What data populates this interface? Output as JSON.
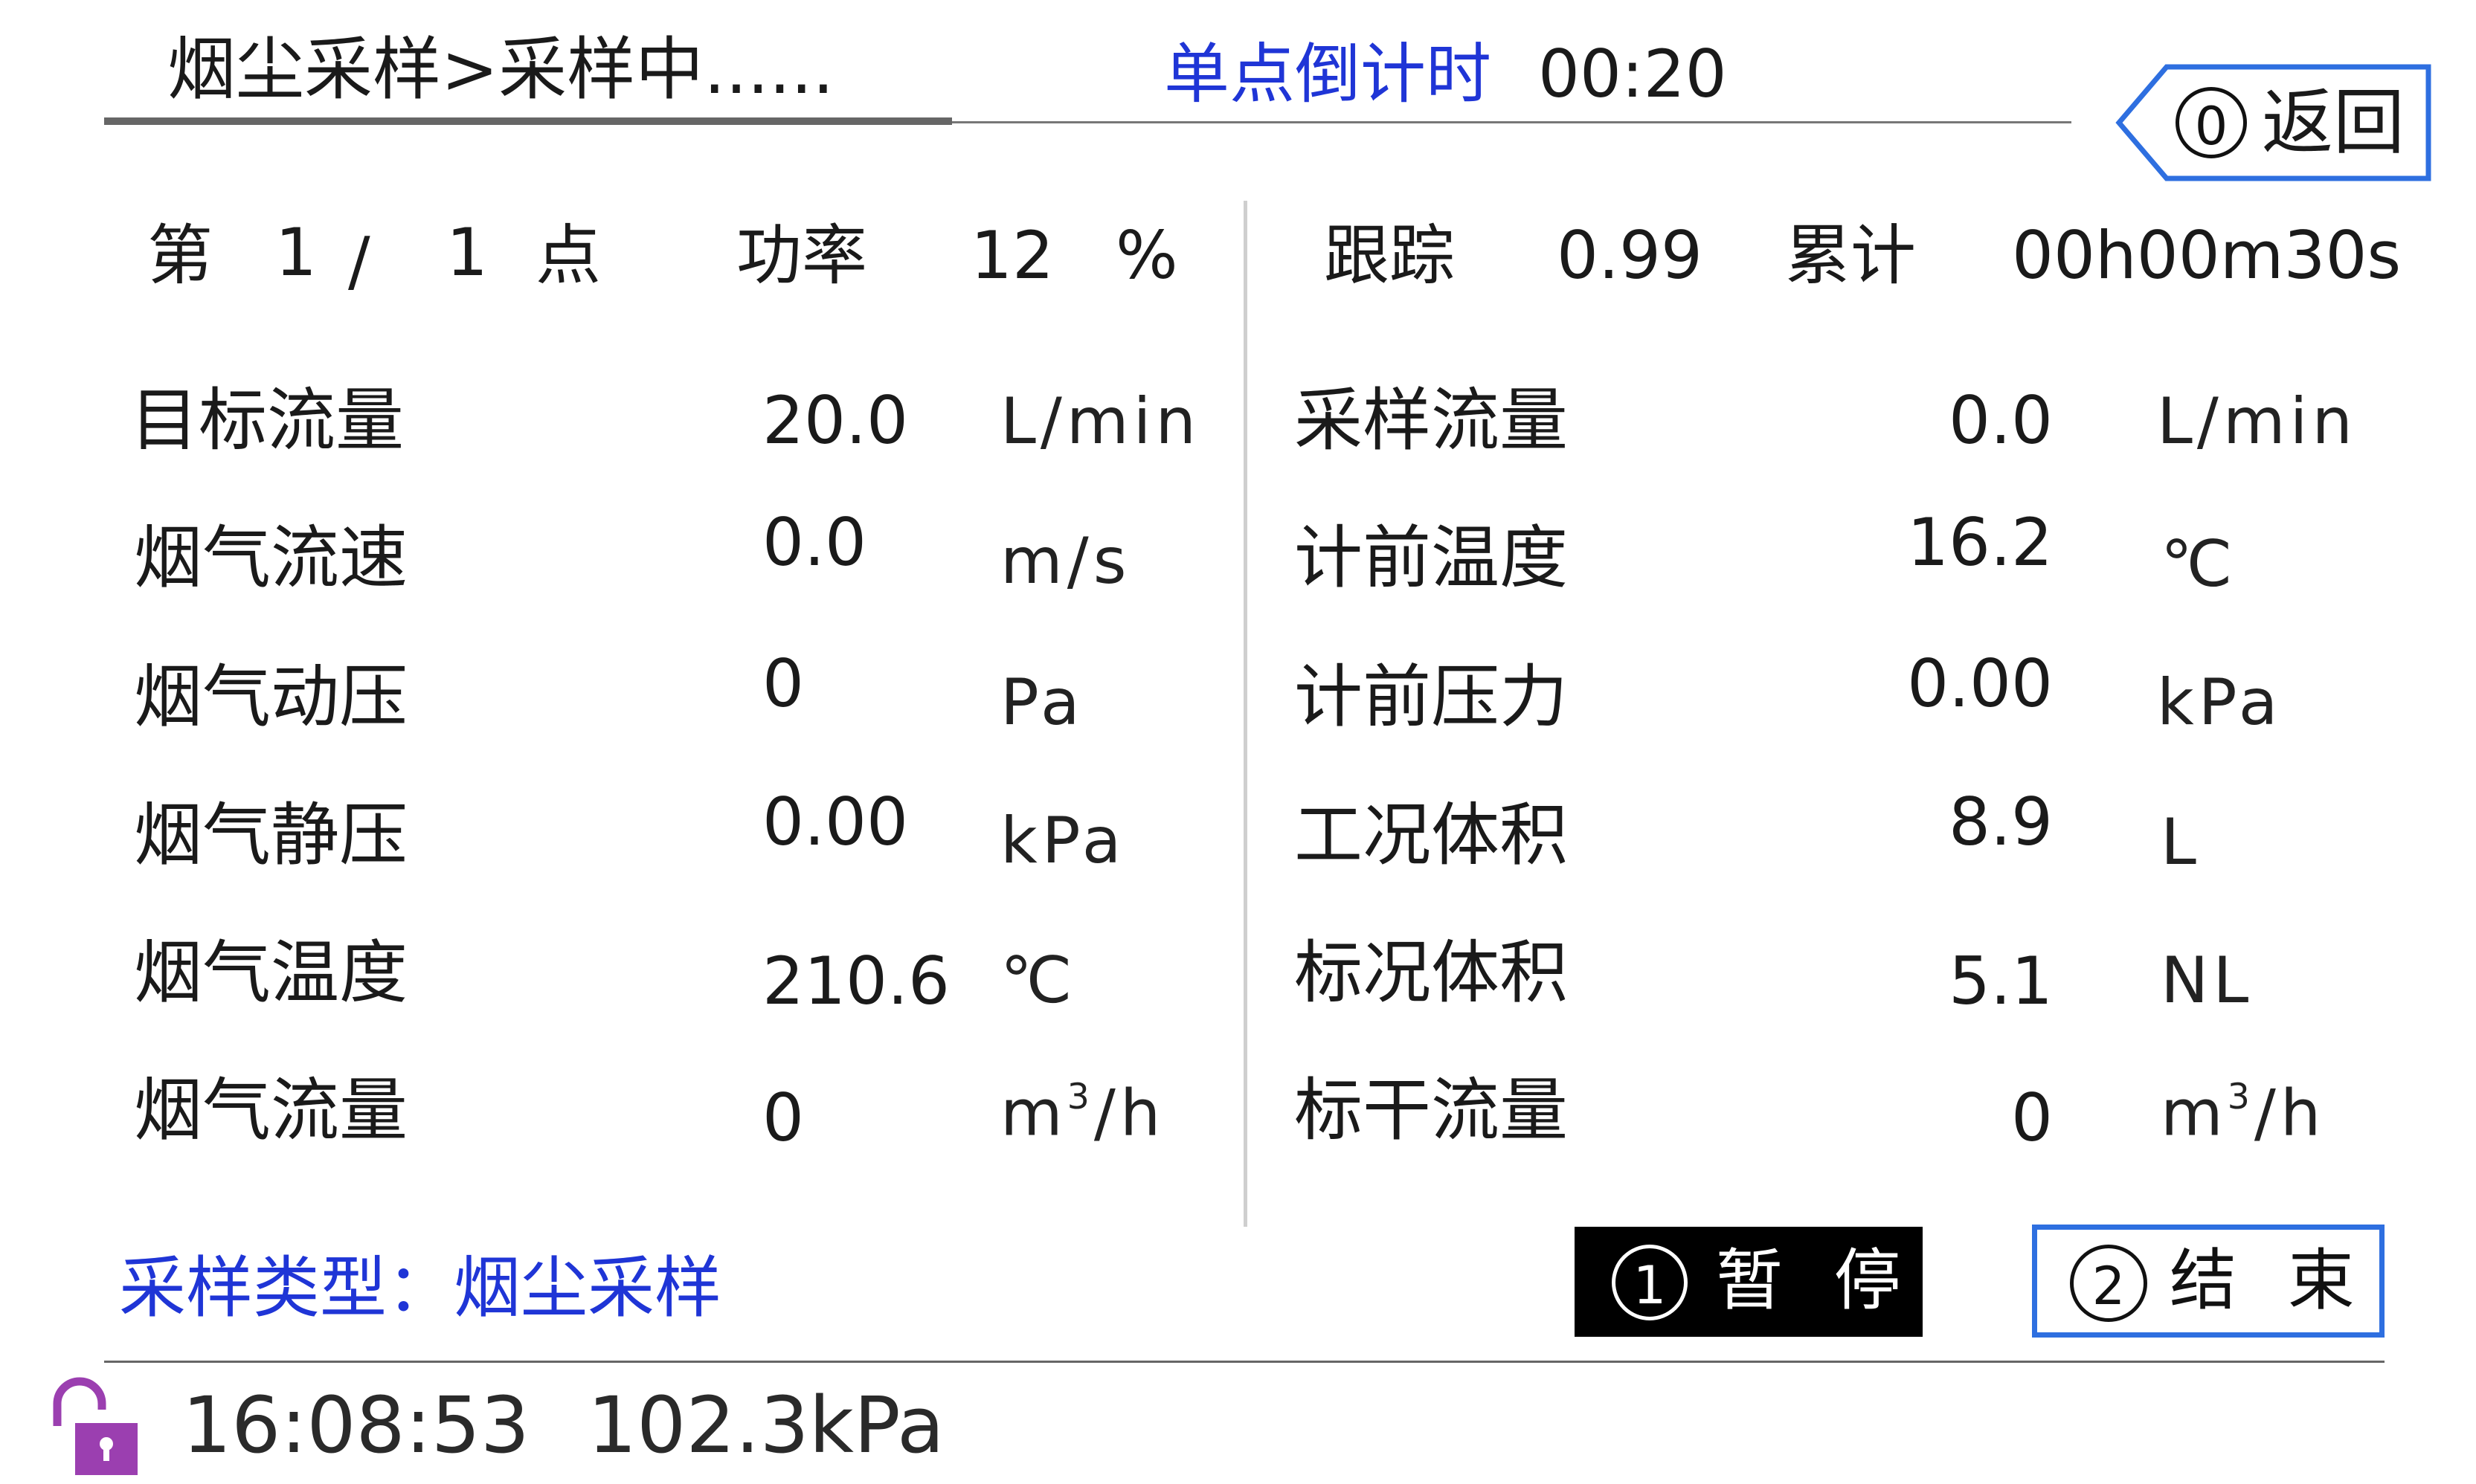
{
  "header": {
    "title": "烟尘采样>采样中......",
    "countdown_label": "单点倒计时",
    "countdown_value": "00:20",
    "back_key": "0",
    "back_label": "返回"
  },
  "status_row": {
    "point_prefix": "第",
    "point_current": "1",
    "point_sep": "/",
    "point_total": "1",
    "point_suffix": "点",
    "power_label": "功率",
    "power_value": "12",
    "power_unit": "%",
    "tracking_label": "跟踪",
    "tracking_value": "0.99",
    "total_label": "累计",
    "total_value": "00h00m30s"
  },
  "left_params": [
    {
      "label": "目标流量",
      "value": "20.0",
      "unit": "L/min"
    },
    {
      "label": "烟气流速",
      "value": "0.0",
      "unit": "m/s"
    },
    {
      "label": "烟气动压",
      "value": "0",
      "unit": "Pa"
    },
    {
      "label": "烟气静压",
      "value": "0.00",
      "unit": "kPa"
    },
    {
      "label": "烟气温度",
      "value": "210.6",
      "unit": "℃"
    },
    {
      "label": "烟气流量",
      "value": "0",
      "unit_base": "m",
      "unit_sup": "3",
      "unit_tail": "/h"
    }
  ],
  "right_params": [
    {
      "label": "采样流量",
      "value": "0.0",
      "unit": "L/min"
    },
    {
      "label": "计前温度",
      "value": "16.2",
      "unit": "℃"
    },
    {
      "label": "计前压力",
      "value": "0.00",
      "unit": "kPa"
    },
    {
      "label": "工况体积",
      "value": "8.9",
      "unit": "L"
    },
    {
      "label": "标况体积",
      "value": "5.1",
      "unit": "NL"
    },
    {
      "label": "标干流量",
      "value": "0",
      "unit_base": "m",
      "unit_sup": "3",
      "unit_tail": "/h"
    }
  ],
  "footer": {
    "sample_type_label": "采样类型：",
    "sample_type_value": "烟尘采样",
    "pause_key": "1",
    "pause_label": "暂 停",
    "end_key": "2",
    "end_label": "结 束",
    "clock": "16:08:53",
    "pressure": "102.3kPa"
  },
  "colors": {
    "accent_blue": "#1f35d6",
    "button_border_blue": "#2e6fe0",
    "lock_purple": "#9b3fb0"
  },
  "icons": {
    "back_arrow": "back-arrow-icon",
    "lock": "unlocked-lock-icon"
  }
}
